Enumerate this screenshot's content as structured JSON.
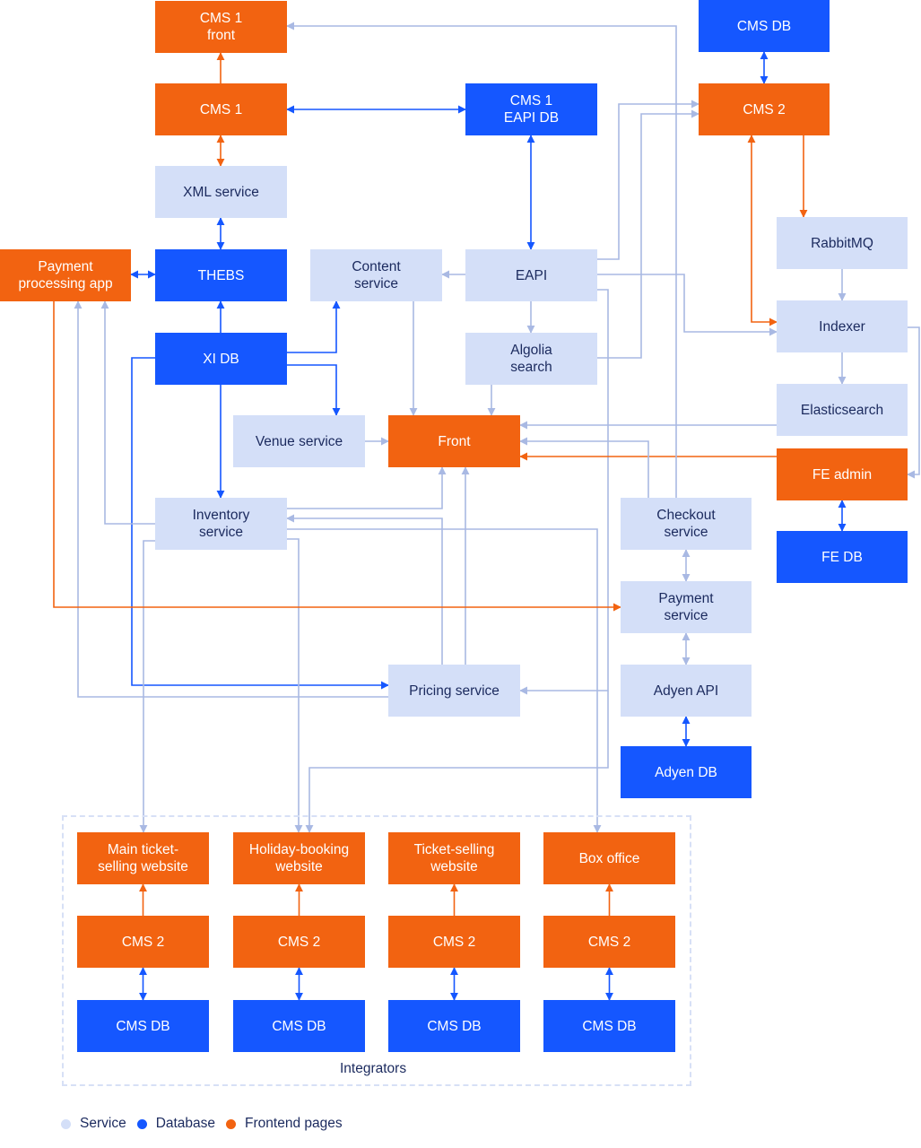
{
  "colors": {
    "service": "#d4dff8",
    "database": "#1557ff",
    "frontend": "#f26311",
    "service_line": "#a9b9e3",
    "database_line": "#1557ff",
    "frontend_line": "#f26311"
  },
  "nodes": [
    {
      "id": "cms1_front",
      "label": "CMS 1\nfront",
      "type": "frontend"
    },
    {
      "id": "cms1",
      "label": "CMS 1",
      "type": "frontend"
    },
    {
      "id": "xml_service",
      "label": "XML service",
      "type": "service"
    },
    {
      "id": "thebs",
      "label": "THEBS",
      "type": "database"
    },
    {
      "id": "payment_app",
      "label": "Payment\nprocessing app",
      "type": "frontend"
    },
    {
      "id": "xi_db",
      "label": "XI DB",
      "type": "database"
    },
    {
      "id": "content_service",
      "label": "Content\nservice",
      "type": "service"
    },
    {
      "id": "cms1_eapi_db",
      "label": "CMS 1\nEAPI DB",
      "type": "database"
    },
    {
      "id": "eapi",
      "label": "EAPI",
      "type": "service"
    },
    {
      "id": "algolia",
      "label": "Algolia\nsearch",
      "type": "service"
    },
    {
      "id": "venue_service",
      "label": "Venue service",
      "type": "service"
    },
    {
      "id": "front",
      "label": "Front",
      "type": "frontend"
    },
    {
      "id": "inventory_service",
      "label": "Inventory\nservice",
      "type": "service"
    },
    {
      "id": "pricing_service",
      "label": "Pricing service",
      "type": "service"
    },
    {
      "id": "cms_db_top",
      "label": "CMS DB",
      "type": "database"
    },
    {
      "id": "cms2",
      "label": "CMS 2",
      "type": "frontend"
    },
    {
      "id": "rabbitmq",
      "label": "RabbitMQ",
      "type": "service"
    },
    {
      "id": "indexer",
      "label": "Indexer",
      "type": "service"
    },
    {
      "id": "elasticsearch",
      "label": "Elasticsearch",
      "type": "service"
    },
    {
      "id": "fe_admin",
      "label": "FE admin",
      "type": "frontend"
    },
    {
      "id": "fe_db",
      "label": "FE DB",
      "type": "database"
    },
    {
      "id": "checkout_service",
      "label": "Checkout\nservice",
      "type": "service"
    },
    {
      "id": "payment_service",
      "label": "Payment\nservice",
      "type": "service"
    },
    {
      "id": "adyen_api",
      "label": "Adyen API",
      "type": "service"
    },
    {
      "id": "adyen_db",
      "label": "Adyen DB",
      "type": "database"
    },
    {
      "id": "int1_site",
      "label": "Main ticket-\nselling website",
      "type": "frontend"
    },
    {
      "id": "int2_site",
      "label": "Holiday-booking\nwebsite",
      "type": "frontend"
    },
    {
      "id": "int3_site",
      "label": "Ticket-selling\nwebsite",
      "type": "frontend"
    },
    {
      "id": "int4_site",
      "label": "Box office",
      "type": "frontend"
    },
    {
      "id": "int1_cms",
      "label": "CMS 2",
      "type": "frontend"
    },
    {
      "id": "int2_cms",
      "label": "CMS 2",
      "type": "frontend"
    },
    {
      "id": "int3_cms",
      "label": "CMS 2",
      "type": "frontend"
    },
    {
      "id": "int4_cms",
      "label": "CMS 2",
      "type": "frontend"
    },
    {
      "id": "int1_db",
      "label": "CMS DB",
      "type": "database"
    },
    {
      "id": "int2_db",
      "label": "CMS DB",
      "type": "database"
    },
    {
      "id": "int3_db",
      "label": "CMS DB",
      "type": "database"
    },
    {
      "id": "int4_db",
      "label": "CMS DB",
      "type": "database"
    }
  ],
  "edges": [
    {
      "from": "cms1",
      "to": "cms1_front",
      "kind": "frontend",
      "bidirectional": false
    },
    {
      "from": "cms1",
      "to": "xml_service",
      "kind": "frontend",
      "bidirectional": true
    },
    {
      "from": "cms1",
      "to": "cms1_eapi_db",
      "kind": "database",
      "bidirectional": true
    },
    {
      "from": "xml_service",
      "to": "thebs",
      "kind": "database",
      "bidirectional": true
    },
    {
      "from": "thebs",
      "to": "payment_app",
      "kind": "database",
      "bidirectional": true
    },
    {
      "from": "xi_db",
      "to": "thebs",
      "kind": "database",
      "bidirectional": false
    },
    {
      "from": "xi_db",
      "to": "content_service",
      "kind": "database",
      "bidirectional": false
    },
    {
      "from": "xi_db",
      "to": "venue_service",
      "kind": "database",
      "bidirectional": false
    },
    {
      "from": "xi_db",
      "to": "inventory_service",
      "kind": "database",
      "bidirectional": false
    },
    {
      "from": "xi_db",
      "to": "pricing_service",
      "kind": "database",
      "bidirectional": false
    },
    {
      "from": "cms1_eapi_db",
      "to": "eapi",
      "kind": "database",
      "bidirectional": true
    },
    {
      "from": "eapi",
      "to": "content_service",
      "kind": "service",
      "bidirectional": false
    },
    {
      "from": "eapi",
      "to": "algolia",
      "kind": "service",
      "bidirectional": false
    },
    {
      "from": "eapi",
      "to": "cms2",
      "kind": "service",
      "bidirectional": false
    },
    {
      "from": "eapi",
      "to": "indexer",
      "kind": "service",
      "bidirectional": false
    },
    {
      "from": "eapi",
      "to": "pricing_service",
      "kind": "service",
      "bidirectional": false
    },
    {
      "from": "eapi",
      "to": "int2_site",
      "kind": "service",
      "bidirectional": false
    },
    {
      "from": "algolia",
      "to": "cms2",
      "kind": "service",
      "bidirectional": false
    },
    {
      "from": "algolia",
      "to": "front",
      "kind": "service",
      "bidirectional": false
    },
    {
      "from": "content_service",
      "to": "front",
      "kind": "service",
      "bidirectional": false
    },
    {
      "from": "venue_service",
      "to": "front",
      "kind": "service",
      "bidirectional": false
    },
    {
      "from": "inventory_service",
      "to": "front",
      "kind": "service",
      "bidirectional": false
    },
    {
      "from": "inventory_service",
      "to": "payment_app",
      "kind": "service",
      "bidirectional": false
    },
    {
      "from": "inventory_service",
      "to": "int1_site",
      "kind": "service",
      "bidirectional": false
    },
    {
      "from": "inventory_service",
      "to": "int2_site",
      "kind": "service",
      "bidirectional": false
    },
    {
      "from": "inventory_service",
      "to": "int4_site",
      "kind": "service",
      "bidirectional": false
    },
    {
      "from": "pricing_service",
      "to": "front",
      "kind": "service",
      "bidirectional": false
    },
    {
      "from": "pricing_service",
      "to": "inventory_service",
      "kind": "service",
      "bidirectional": false
    },
    {
      "from": "pricing_service",
      "to": "payment_app",
      "kind": "service",
      "bidirectional": false
    },
    {
      "from": "cms_db_top",
      "to": "cms2",
      "kind": "database",
      "bidirectional": true
    },
    {
      "from": "cms2",
      "to": "rabbitmq",
      "kind": "frontend",
      "bidirectional": false
    },
    {
      "from": "cms2",
      "to": "indexer",
      "kind": "frontend",
      "bidirectional": true
    },
    {
      "from": "rabbitmq",
      "to": "indexer",
      "kind": "service",
      "bidirectional": false
    },
    {
      "from": "indexer",
      "to": "elasticsearch",
      "kind": "service",
      "bidirectional": false
    },
    {
      "from": "indexer",
      "to": "fe_admin",
      "kind": "service",
      "bidirectional": false
    },
    {
      "from": "elasticsearch",
      "to": "front",
      "kind": "service",
      "bidirectional": false
    },
    {
      "from": "fe_admin",
      "to": "front",
      "kind": "frontend",
      "bidirectional": false
    },
    {
      "from": "fe_admin",
      "to": "fe_db",
      "kind": "database",
      "bidirectional": true
    },
    {
      "from": "checkout_service",
      "to": "front",
      "kind": "service",
      "bidirectional": false
    },
    {
      "from": "checkout_service",
      "to": "cms1_front",
      "kind": "service",
      "bidirectional": false
    },
    {
      "from": "checkout_service",
      "to": "payment_service",
      "kind": "service",
      "bidirectional": true
    },
    {
      "from": "payment_app",
      "to": "payment_service",
      "kind": "frontend",
      "bidirectional": false
    },
    {
      "from": "payment_service",
      "to": "adyen_api",
      "kind": "service",
      "bidirectional": true
    },
    {
      "from": "adyen_api",
      "to": "adyen_db",
      "kind": "database",
      "bidirectional": true
    },
    {
      "from": "int1_cms",
      "to": "int1_site",
      "kind": "frontend",
      "bidirectional": false
    },
    {
      "from": "int2_cms",
      "to": "int2_site",
      "kind": "frontend",
      "bidirectional": false
    },
    {
      "from": "int3_cms",
      "to": "int3_site",
      "kind": "frontend",
      "bidirectional": false
    },
    {
      "from": "int4_cms",
      "to": "int4_site",
      "kind": "frontend",
      "bidirectional": false
    },
    {
      "from": "int1_cms",
      "to": "int1_db",
      "kind": "database",
      "bidirectional": true
    },
    {
      "from": "int2_cms",
      "to": "int2_db",
      "kind": "database",
      "bidirectional": true
    },
    {
      "from": "int3_cms",
      "to": "int3_db",
      "kind": "database",
      "bidirectional": true
    },
    {
      "from": "int4_cms",
      "to": "int4_db",
      "kind": "database",
      "bidirectional": true
    }
  ],
  "group": {
    "label": "Integrators"
  },
  "legend": [
    {
      "label": "Service",
      "type": "service"
    },
    {
      "label": "Database",
      "type": "database"
    },
    {
      "label": "Frontend pages",
      "type": "frontend"
    }
  ]
}
